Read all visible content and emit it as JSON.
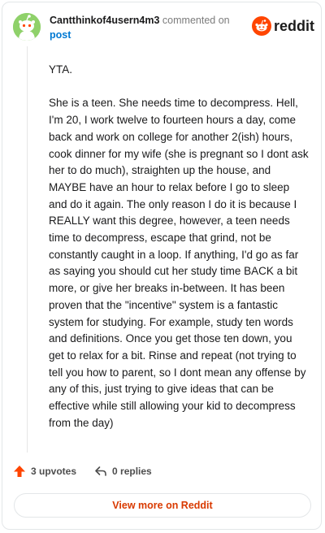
{
  "header": {
    "username": "Cantthinkof4usern4m3",
    "action_text": " commented on ",
    "target_link": "post",
    "brand": "reddit",
    "brand_color": "#ff4500",
    "avatar_color": "#8fd16a"
  },
  "comment": {
    "paragraphs": [
      "YTA.",
      "She is a teen. She needs time to decompress. Hell, I'm 20, I work twelve to fourteen hours a day, come back and work on college for another 2(ish) hours, cook dinner for my wife (she is pregnant so I dont ask her to do much), straighten up the house, and MAYBE have an hour to relax before I go to sleep and do it again. The only reason I do it is because I REALLY want this degree, however, a teen needs time to decompress, escape that grind, not be constantly caught in a loop. If anything, I'd go as far as saying you should cut her study time BACK a bit more, or give her breaks in-between. It has been proven that the \"incentive\" system is a fantastic system for studying. For example, study ten words and definitions. Once you get those ten down, you get to relax for a bit. Rinse and repeat (not trying to tell you how to parent, so I dont mean any offense by any of this, just trying to give ideas that can be effective while still allowing your kid to decompress from the day)"
    ]
  },
  "actions": {
    "upvotes": "3 upvotes",
    "replies": "0 replies",
    "upvote_icon": "arrow-up-icon",
    "reply_icon": "reply-icon",
    "upvote_color": "#ff4500"
  },
  "footer": {
    "view_more": "View more on Reddit",
    "view_more_color": "#d93a00"
  }
}
